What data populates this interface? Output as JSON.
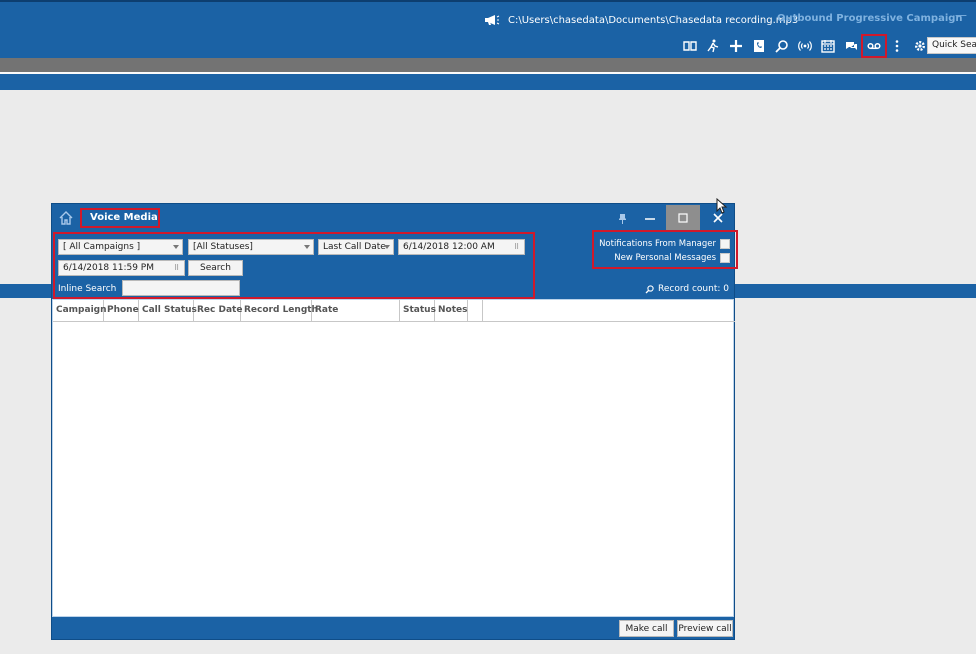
{
  "topbar": {
    "recording_path": "C:\\Users\\chasedata\\Documents\\Chasedata recording.mp3",
    "campaign": "Outbound Progressive Campaign",
    "minimize_glyph": "—",
    "quick_search": "Quick Sear",
    "tool_icons": [
      "book-icon",
      "agent-walk-icon",
      "plus-icon",
      "phone-book-icon",
      "search-icon",
      "broadcast-icon",
      "calendar-icon",
      "chat-icon",
      "voicemail-icon",
      "more-icon",
      "settings-icon"
    ]
  },
  "dialog": {
    "title": "Voice Media",
    "filters": {
      "campaign": "[ All Campaigns ]",
      "status": "[All Statuses]",
      "date_field": "Last Call Date",
      "start_date": "6/14/2018 12:00 AM",
      "end_date": "6/14/2018 11:59 PM",
      "search_button": "Search",
      "inline_search_label": "Inline Search",
      "inline_search_value": ""
    },
    "notifications": {
      "manager": "Notifications From Manager",
      "personal": "New Personal Messages"
    },
    "record_count": "Record count: 0",
    "columns": [
      "Campaign",
      "Phone",
      "Call Status",
      "Rec Date",
      "Record Length",
      "Rate",
      "Status",
      "Notes"
    ],
    "make_call": "Make call",
    "preview_call": "Preview call"
  },
  "colors": {
    "brand_blue": "#1b62a5",
    "highlight_red": "#d0192b"
  }
}
